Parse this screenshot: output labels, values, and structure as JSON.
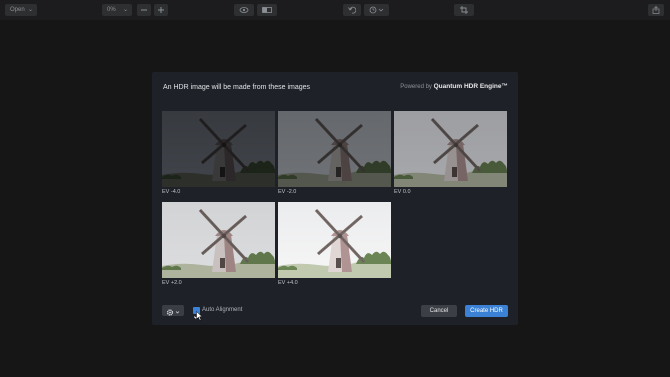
{
  "toolbar": {
    "open_label": "Open",
    "zoom_value": "0%",
    "icons": [
      "zoom-out-icon",
      "zoom-in-icon",
      "eye-icon",
      "compare-icon",
      "undo-icon",
      "history-icon",
      "crop-icon",
      "share-icon"
    ]
  },
  "dialog": {
    "title": "An HDR image will be made from these images",
    "powered_prefix": "Powered by",
    "powered_brand": "Quantum HDR Engine™",
    "images": [
      {
        "caption": "EV -4.0",
        "brightness": 0.18
      },
      {
        "caption": "EV -2.0",
        "brightness": 0.38
      },
      {
        "caption": "EV 0.0",
        "brightness": 0.62
      },
      {
        "caption": "EV +2.0",
        "brightness": 0.85
      },
      {
        "caption": "EV +4.0",
        "brightness": 0.96
      }
    ],
    "auto_alignment_label": "Auto Alignment",
    "auto_alignment_checked": true,
    "cancel_label": "Cancel",
    "create_label": "Create HDR"
  },
  "colors": {
    "accent": "#3b82d6",
    "background": "#161617",
    "dialog": "#1f2128"
  }
}
